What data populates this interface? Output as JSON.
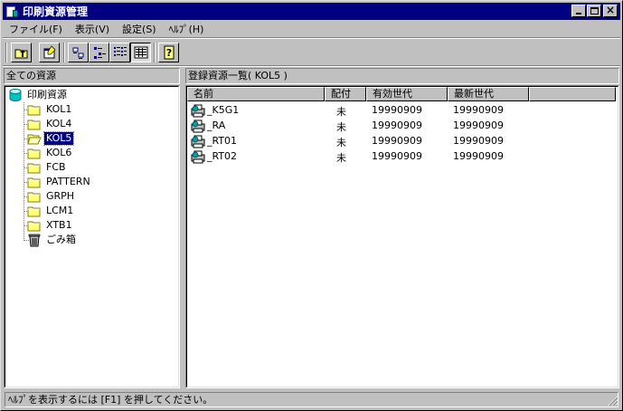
{
  "window": {
    "title": "印刷資源管理",
    "controls": {
      "minimize": "minimize",
      "maximize": "maximize",
      "close": "×"
    }
  },
  "menu": [
    {
      "label": "ファイル(F)"
    },
    {
      "label": "表示(V)"
    },
    {
      "label": "設定(S)"
    },
    {
      "label": "ﾍﾙﾌﾟ(H)"
    }
  ],
  "toolbar": {
    "buttons": [
      {
        "icon": "up-folder-icon"
      },
      {
        "icon": "properties-icon"
      },
      {
        "icon": "large-icons-view-icon"
      },
      {
        "icon": "small-icons-view-icon"
      },
      {
        "icon": "list-view-icon"
      },
      {
        "icon": "details-view-icon",
        "pressed": true
      },
      {
        "icon": "help-icon"
      }
    ]
  },
  "tree": {
    "header": "全ての資源",
    "root": {
      "label": "印刷資源",
      "icon": "database-icon"
    },
    "items": [
      {
        "label": "KOL1",
        "icon": "folder-icon"
      },
      {
        "label": "KOL4",
        "icon": "folder-icon"
      },
      {
        "label": "KOL5",
        "icon": "open-folder-icon",
        "selected": true
      },
      {
        "label": "KOL6",
        "icon": "folder-icon"
      },
      {
        "label": "FCB",
        "icon": "folder-icon"
      },
      {
        "label": "PATTERN",
        "icon": "folder-icon"
      },
      {
        "label": "GRPH",
        "icon": "folder-icon"
      },
      {
        "label": "LCM1",
        "icon": "folder-icon"
      },
      {
        "label": "XTB1",
        "icon": "folder-icon"
      },
      {
        "label": "ごみ箱",
        "icon": "trash-icon"
      }
    ]
  },
  "list": {
    "header": "登録資源一覧( KOL5 )",
    "columns": [
      {
        "label": "名前"
      },
      {
        "label": "配付"
      },
      {
        "label": "有効世代"
      },
      {
        "label": "最新世代"
      },
      {
        "label": ""
      }
    ],
    "rows": [
      {
        "name": "_K5G1",
        "distribution": "未",
        "effective": "19990909",
        "latest": "19990909"
      },
      {
        "name": "_RA",
        "distribution": "未",
        "effective": "19990909",
        "latest": "19990909"
      },
      {
        "name": "_RT01",
        "distribution": "未",
        "effective": "19990909",
        "latest": "19990909"
      },
      {
        "name": "_RT02",
        "distribution": "未",
        "effective": "19990909",
        "latest": "19990909"
      }
    ]
  },
  "status": {
    "text": "ﾍﾙﾌﾟを表示するには [F1] を押してください。"
  },
  "colors": {
    "titlebar": "#000080",
    "face": "#c0c0c0",
    "selection": "#000080"
  }
}
